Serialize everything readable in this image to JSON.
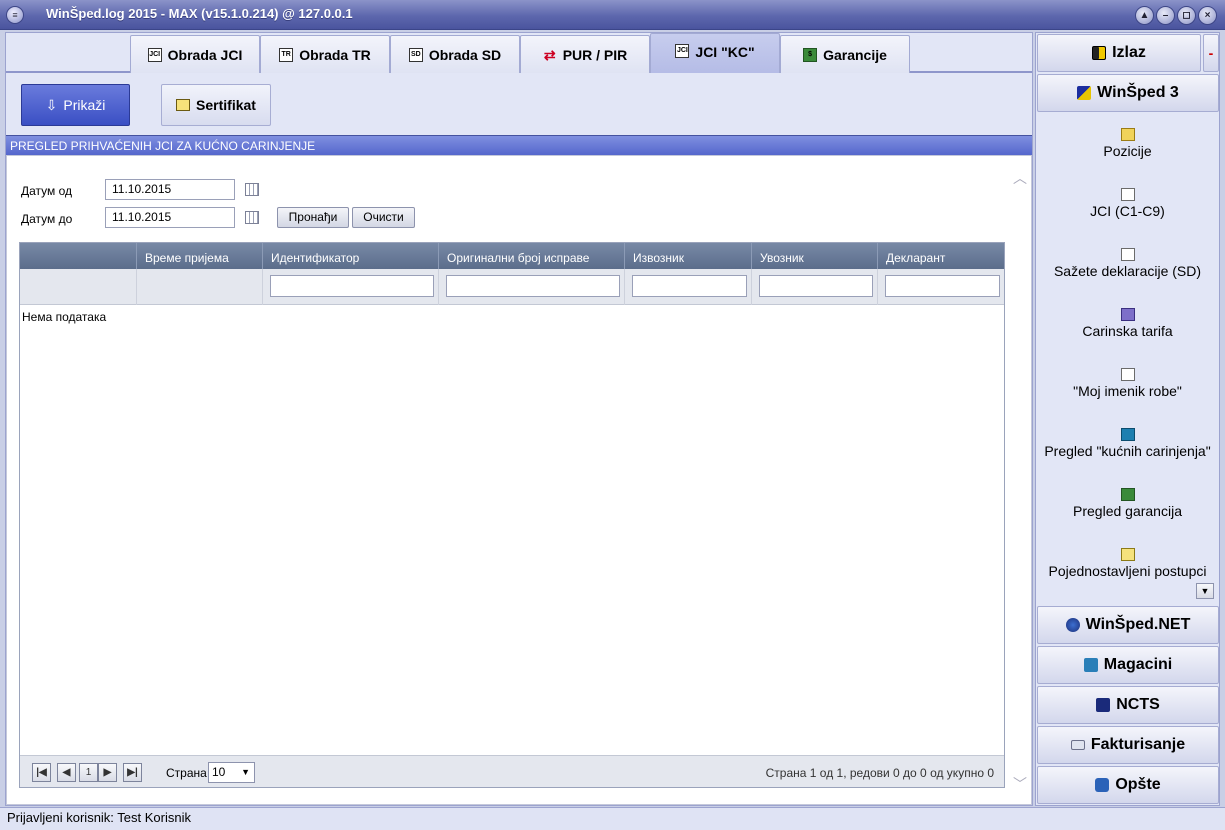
{
  "window": {
    "title": "WinŠped.log 2015 - MAX (v15.1.0.214) @ 127.0.0.1",
    "app_icon": "≡",
    "buttons": [
      "▲",
      "–",
      "◻",
      "×"
    ]
  },
  "tabs": [
    {
      "label": "Obrada JCI",
      "icon": "JCI"
    },
    {
      "label": "Obrada TR",
      "icon": "TR"
    },
    {
      "label": "Obrada SD",
      "icon": "SD"
    },
    {
      "label": "PUR / PIR",
      "icon": "⇄"
    },
    {
      "label": "JCI \"KC\"",
      "icon": "JCI",
      "active": true
    },
    {
      "label": "Garancije",
      "icon": "$"
    }
  ],
  "toolbar": {
    "prikazi_label": "Prikaži",
    "prikazi_icon": "⇩",
    "sertifikat_label": "Sertifikat"
  },
  "section_title": "PREGLED PRIHVAĆENIH JCI ZA KUĆNO CARINJENJE",
  "filters": {
    "date_from_label": "Датум од",
    "date_from_value": "11.10.2015",
    "date_to_label": "Датум до",
    "date_to_value": "11.10.2015",
    "find_label": "Пронађи",
    "clear_label": "Очисти"
  },
  "grid": {
    "columns": [
      "",
      "Време пријема",
      "Идентификатор",
      "Оригинални број исправе",
      "Извозник",
      "Увозник",
      "Декларант"
    ],
    "empty_text": "Нема података",
    "pager": {
      "first": "|◀",
      "prev": "◀",
      "page": "1",
      "next": "▶",
      "last": "▶|",
      "page_label": "Страна",
      "page_size": "10",
      "info": "Страна 1 од 1, редови 0 до 0 од укупно 0"
    }
  },
  "right_panel": {
    "izlaz_label": "Izlaz",
    "minus_label": "-",
    "winsped3_label": "WinŠped 3",
    "items": [
      {
        "label": "Pozicije",
        "icon": "folder-icon"
      },
      {
        "label": "JCI (C1-C9)",
        "icon": "jci-document-icon"
      },
      {
        "label": "Sažete deklaracije (SD)",
        "icon": "sd-document-icon"
      },
      {
        "label": "Carinska tarifa",
        "icon": "tariff-icon"
      },
      {
        "label": "\"Moj imenik robe\"",
        "icon": "book-icon"
      },
      {
        "label": "Pregled \"kućnih carinjenja\"",
        "icon": "house-customs-icon"
      },
      {
        "label": "Pregled garancija",
        "icon": "guarantee-icon"
      },
      {
        "label": "Pojednostavljeni postupci",
        "icon": "simplified-procedure-icon"
      }
    ],
    "more_arrow": "▼",
    "bottom_buttons": [
      "WinŠped.NET",
      "Magacini",
      "NCTS",
      "Fakturisanje",
      "Opšte"
    ]
  },
  "status": "Prijavljeni korisnik: Test Korisnik",
  "colors": {
    "accent": "#5567cc",
    "grid_header": "#6a7b99"
  }
}
